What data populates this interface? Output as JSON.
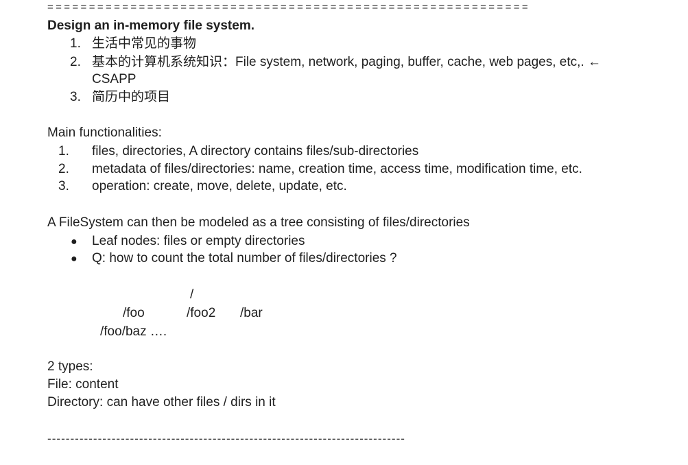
{
  "top_separator": "==========================================================",
  "title": "Design an in-memory file system.",
  "sources": {
    "numbers": [
      "1.",
      "2.",
      "3."
    ],
    "items": [
      "生活中常见的事物",
      "基本的计算机系统知识：File system, network, paging, buffer, cache, web pages, etc,. ←",
      "简历中的项目"
    ],
    "item2_continuation": "CSAPP"
  },
  "functionalities": {
    "heading": "Main functionalities:",
    "numbers": [
      "1.",
      "2.",
      "3."
    ],
    "items": [
      "files, directories, A directory contains files/sub-directories",
      "metadata of files/directories: name, creation time, access time, modification time, etc.",
      "operation: create, move, delete, update, etc."
    ]
  },
  "tree_model": {
    "intro": "A FileSystem can then be modeled as a tree consisting of files/directories",
    "bullet_symbol": "●",
    "bullets": [
      "Leaf nodes: files or empty directories",
      "Q: how to count the total number of files/directories ?"
    ]
  },
  "tree_diagram": {
    "root": "/",
    "children": [
      "/foo",
      "/foo2",
      "/bar"
    ],
    "grandchild": "/foo/baz …."
  },
  "types": {
    "heading": "2 types:",
    "file": "File: content",
    "directory": "Directory: can have other files / dirs in it"
  },
  "bottom_separator": "------------------------------------------------------------------------------"
}
